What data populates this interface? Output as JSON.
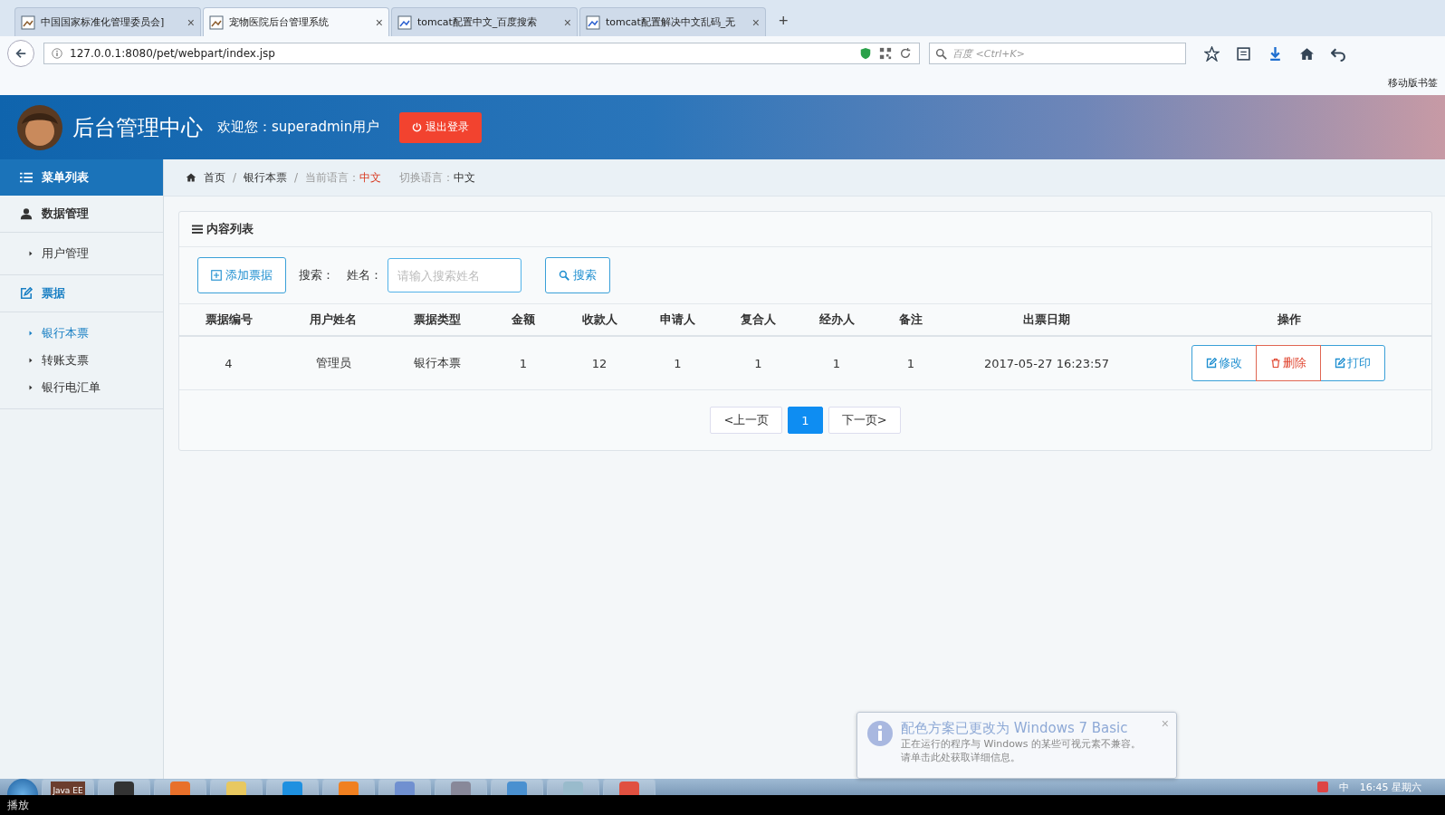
{
  "browser": {
    "tabs": [
      {
        "title": "中国国家标准化管理委员会]",
        "selected": false
      },
      {
        "title": "宠物医院后台管理系统",
        "selected": true
      },
      {
        "title": "tomcat配置中文_百度搜索",
        "selected": false
      },
      {
        "title": "tomcat配置解决中文乱码_无",
        "selected": false
      }
    ],
    "close": "×",
    "new_tab": "+",
    "url": "127.0.0.1:8080/pet/webpart/index.jsp",
    "search_placeholder": "百度 <Ctrl+K>",
    "bookmark": "移动版书签"
  },
  "header": {
    "title": "后台管理中心",
    "welcome": "欢迎您：superadmin用户",
    "logout": "退出登录"
  },
  "sidebar": {
    "heading": "菜单列表",
    "groups": [
      {
        "label": "数据管理",
        "kind": "user",
        "selected": false,
        "children": [
          {
            "label": "用户管理",
            "selected": false
          }
        ]
      },
      {
        "label": "票据",
        "kind": "edit",
        "selected": true,
        "children": [
          {
            "label": "银行本票",
            "selected": true
          },
          {
            "label": "转账支票",
            "selected": false
          },
          {
            "label": "银行电汇单",
            "selected": false
          }
        ]
      }
    ]
  },
  "breadcrumb": {
    "separator": "/",
    "home": "首页",
    "current": "银行本票",
    "lang_label": "当前语言：",
    "lang_value": "中文",
    "switch_label": "切换语言：",
    "switch_value": "中文"
  },
  "panel": {
    "title": "内容列表",
    "add_button": "添加票据",
    "search_label": "搜索：",
    "name_label": "姓名：",
    "name_placeholder": "请输入搜索姓名",
    "search_button": "搜索"
  },
  "table": {
    "columns": [
      "票据编号",
      "用户姓名",
      "票据类型",
      "金额",
      "收款人",
      "申请人",
      "复合人",
      "经办人",
      "备注",
      "出票日期",
      "操作"
    ],
    "rows": [
      {
        "cells": [
          "4",
          "管理员",
          "银行本票",
          "1",
          "12",
          "1",
          "1",
          "1",
          "1",
          "2017-05-27 16:23:57"
        ],
        "actions": [
          {
            "label": "修改",
            "kind": "edit"
          },
          {
            "label": "删除",
            "kind": "delete"
          },
          {
            "label": "打印",
            "kind": "edit"
          }
        ]
      }
    ]
  },
  "pagination": {
    "prev": "<上一页",
    "pages": [
      {
        "label": "1",
        "selected": true
      }
    ],
    "next": "下一页>"
  },
  "notification": {
    "title": "配色方案已更改为 Windows 7 Basic",
    "lines": [
      "正在运行的程序与 Windows 的某些可视元素不兼容。",
      "请单击此处获取详细信息。"
    ],
    "close": "×"
  },
  "taskbar": {
    "app_label": "Java EE",
    "ime": "中",
    "clock": "16:45 星期六"
  },
  "status": "播放"
}
